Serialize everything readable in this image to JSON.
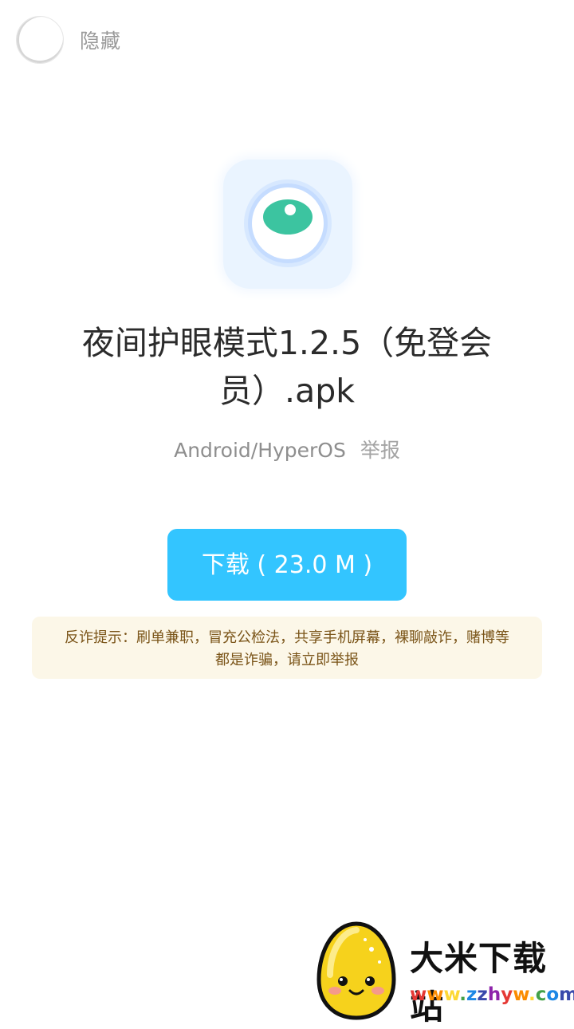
{
  "header": {
    "hide_label": "隐藏"
  },
  "app": {
    "icon": "eye-icon",
    "title_line1": "夜间护眼模式1.2.5（免登会",
    "title_line2": "员）.apk",
    "platform": "Android/HyperOS",
    "report_label": "举报",
    "download_label": "下载 ( 23.0 M )"
  },
  "notice": {
    "line1": "反诈提示：刷单兼职，冒充公检法，共享手机屏幕，裸聊敲诈，赌博等",
    "line2": "都是诈骗，请立即举报"
  },
  "watermark": {
    "name": "大米下载站",
    "url": "www.zzhyw.com"
  },
  "colors": {
    "button": "#33c5ff",
    "notice_bg": "#fcf7e8",
    "notice_text": "#7a5418",
    "eye": "#3cc4a0"
  }
}
